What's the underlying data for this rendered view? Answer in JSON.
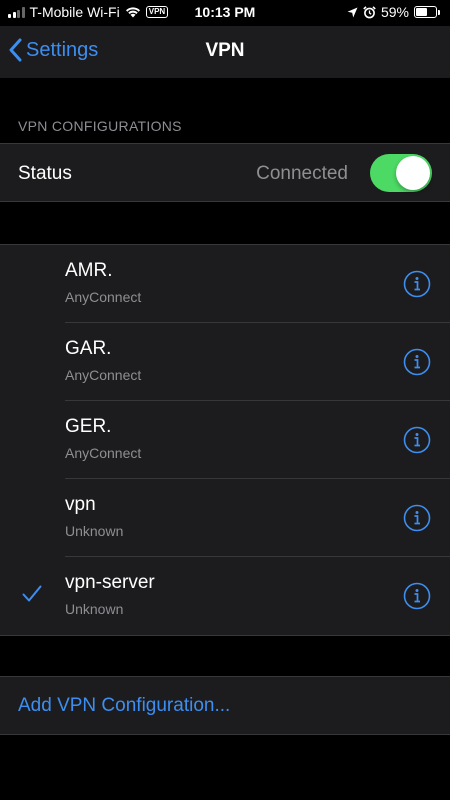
{
  "status_bar": {
    "carrier": "T-Mobile Wi-Fi",
    "vpn_badge": "VPN",
    "time": "10:13 PM",
    "battery": "59%",
    "battery_level": 0.59
  },
  "nav": {
    "back_label": "Settings",
    "title": "VPN"
  },
  "section": {
    "header": "VPN CONFIGURATIONS"
  },
  "status_row": {
    "label": "Status",
    "value": "Connected",
    "toggle_on": true
  },
  "configurations": [
    {
      "name": "AMR.",
      "type": "AnyConnect",
      "selected": false
    },
    {
      "name": "GAR.",
      "type": "AnyConnect",
      "selected": false
    },
    {
      "name": "GER.",
      "type": "AnyConnect",
      "selected": false
    },
    {
      "name": "vpn",
      "type": "Unknown",
      "selected": false
    },
    {
      "name": "vpn-server",
      "type": "Unknown",
      "selected": true
    }
  ],
  "add_config": {
    "label": "Add VPN Configuration..."
  },
  "colors": {
    "accent": "#3d8ef0",
    "toggle_on": "#4cd964",
    "secondary_text": "#8e8e93",
    "cell_bg": "#1c1c1e",
    "page_bg": "#000000"
  }
}
